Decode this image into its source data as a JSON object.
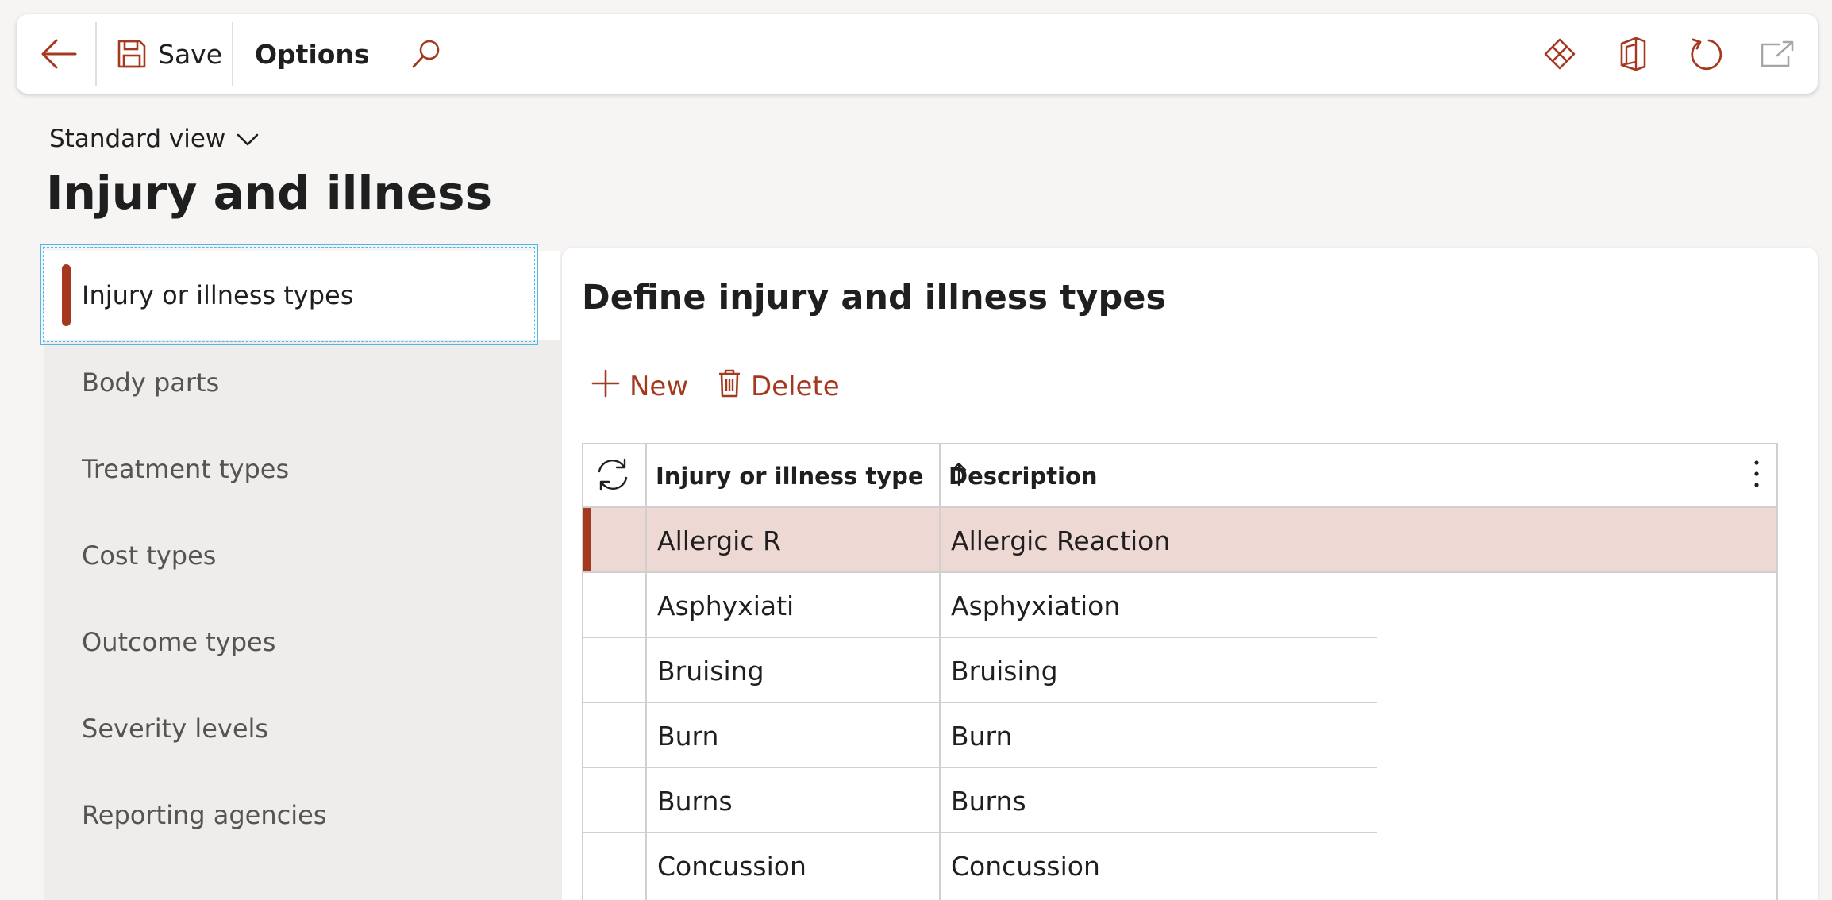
{
  "toolbar": {
    "save_label": "Save",
    "options_label": "Options",
    "back_icon": "back-arrow-icon",
    "save_icon": "floppy-disk-icon",
    "search_icon": "search-icon",
    "right_icons": [
      "power-apps-icon",
      "office-icon",
      "refresh-icon",
      "open-new-window-icon"
    ]
  },
  "header": {
    "view_label": "Standard view",
    "title": "Injury and illness"
  },
  "nav": {
    "items": [
      {
        "label": "Injury or illness types"
      },
      {
        "label": "Body parts"
      },
      {
        "label": "Treatment types"
      },
      {
        "label": "Cost types"
      },
      {
        "label": "Outcome types"
      },
      {
        "label": "Severity levels"
      },
      {
        "label": "Reporting agencies"
      }
    ],
    "active_index": 0
  },
  "main": {
    "section_title": "Define injury and illness types",
    "actions": {
      "new_label": "New",
      "delete_label": "Delete"
    },
    "grid": {
      "columns": [
        "Injury or illness type",
        "Description"
      ],
      "sort": {
        "column": "Injury or illness type",
        "direction": "ascending"
      },
      "rows": [
        {
          "type": "Allergic R",
          "description": "Allergic Reaction",
          "selected": true
        },
        {
          "type": "Asphyxiati",
          "description": "Asphyxiation",
          "selected": false
        },
        {
          "type": "Bruising",
          "description": "Bruising",
          "selected": false
        },
        {
          "type": "Burn",
          "description": "Burn",
          "selected": false
        },
        {
          "type": "Burns",
          "description": "Burns",
          "selected": false
        },
        {
          "type": "Concussion",
          "description": "Concussion",
          "selected": false
        }
      ]
    }
  },
  "colors": {
    "accent": "#a5391f",
    "selected_row": "#eed8d4",
    "focus": "#4fb8e8",
    "page_bg": "#f6f5f4",
    "nav_bg": "#efedeb"
  }
}
